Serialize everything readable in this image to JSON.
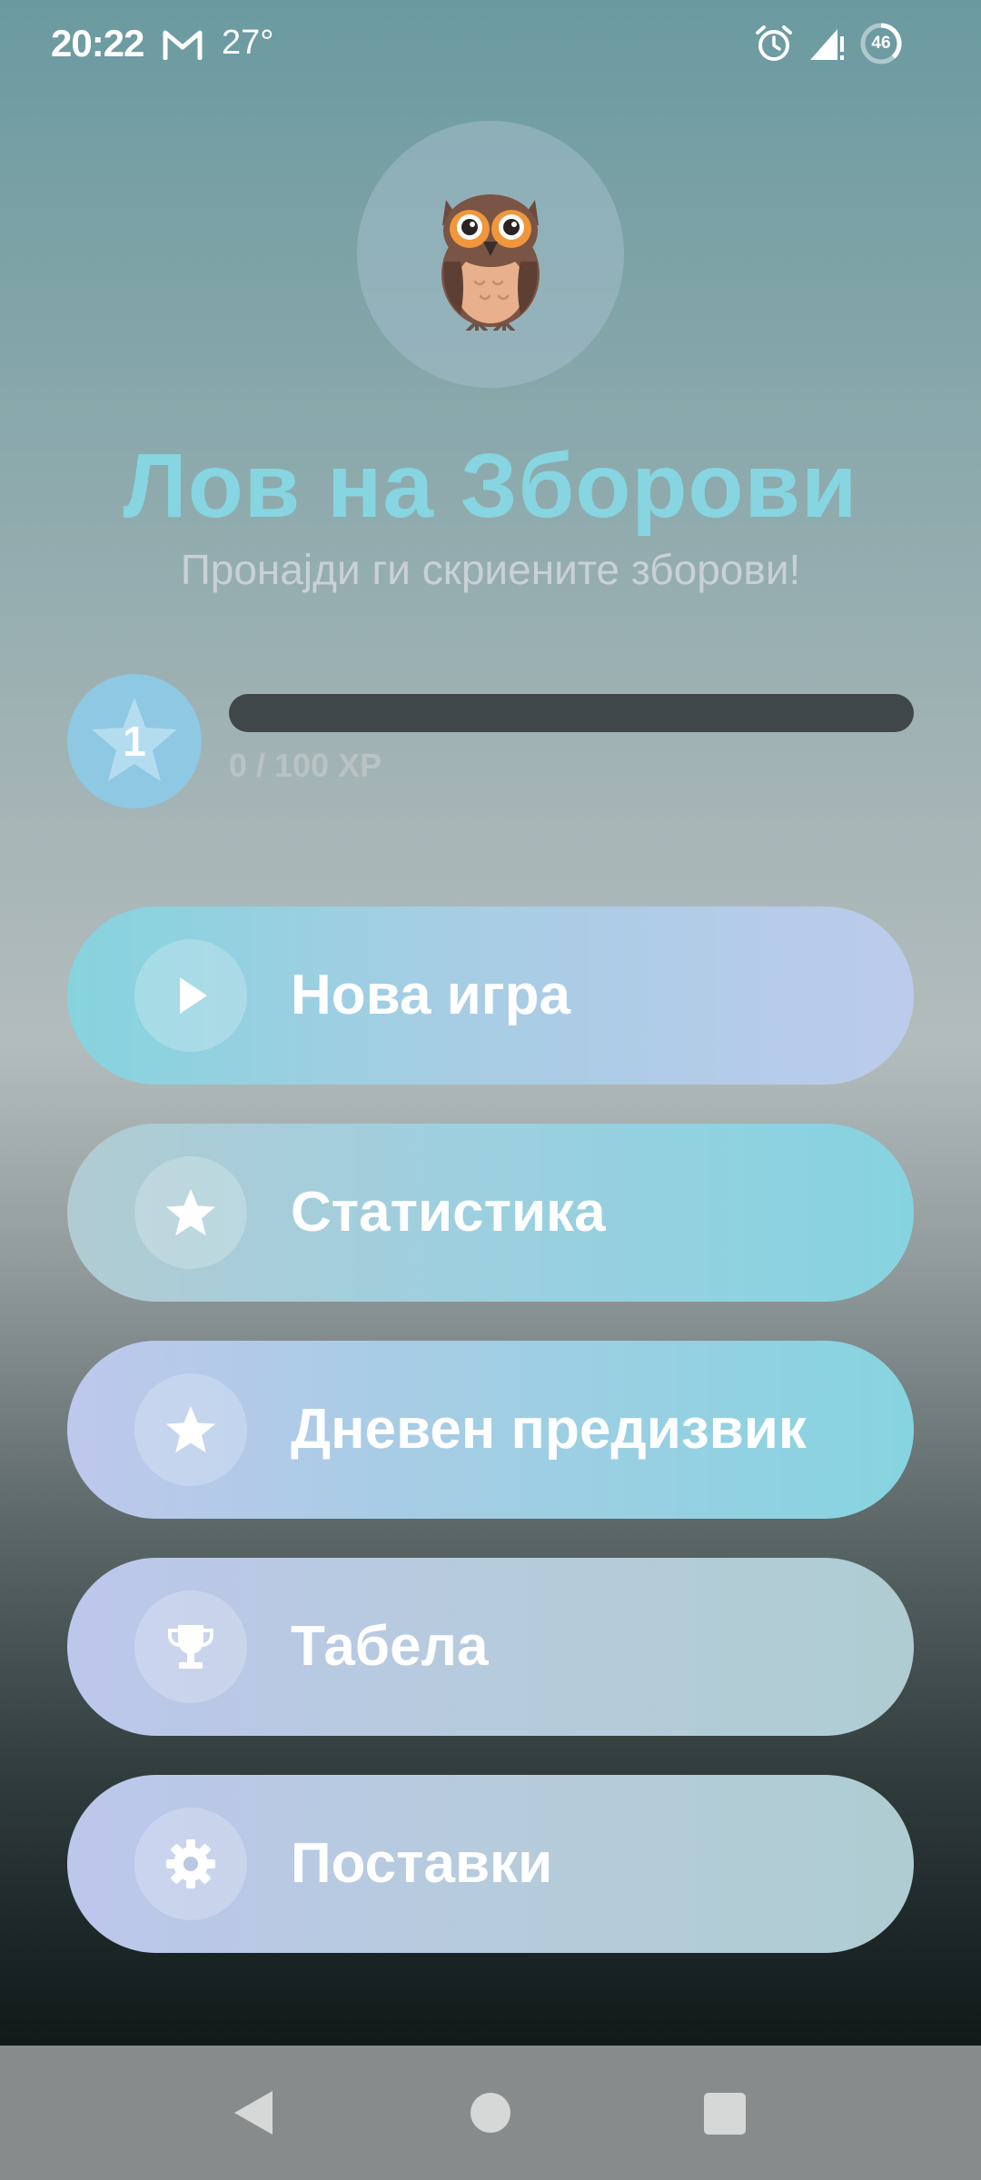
{
  "status_bar": {
    "time": "20:22",
    "temperature": "27°",
    "battery": "46",
    "icons": [
      "gmail-icon",
      "alarm-icon",
      "signal-icon",
      "battery-icon"
    ]
  },
  "header": {
    "logo_icon": "owl-icon",
    "title": "Лов на Зборови",
    "subtitle": "Пронајди ги скриените зборови!"
  },
  "level": {
    "number": "1",
    "xp_text": "0 / 100 XP",
    "progress_fraction": 0
  },
  "menu": {
    "new_game": {
      "label": "Нова игра",
      "icon": "play-icon"
    },
    "stats": {
      "label": "Статистика",
      "icon": "star-icon"
    },
    "daily": {
      "label": "Дневен предизвик",
      "icon": "star-icon"
    },
    "leaderboard": {
      "label": "Табела",
      "icon": "trophy-icon"
    },
    "settings": {
      "label": "Поставки",
      "icon": "gear-icon"
    }
  },
  "nav_bar": {
    "icons": [
      "back-icon",
      "home-icon",
      "recents-icon"
    ]
  },
  "colors": {
    "accent": "#86d5e0",
    "button_lavender": "#bccbec",
    "xp_track": "#3f4748"
  }
}
